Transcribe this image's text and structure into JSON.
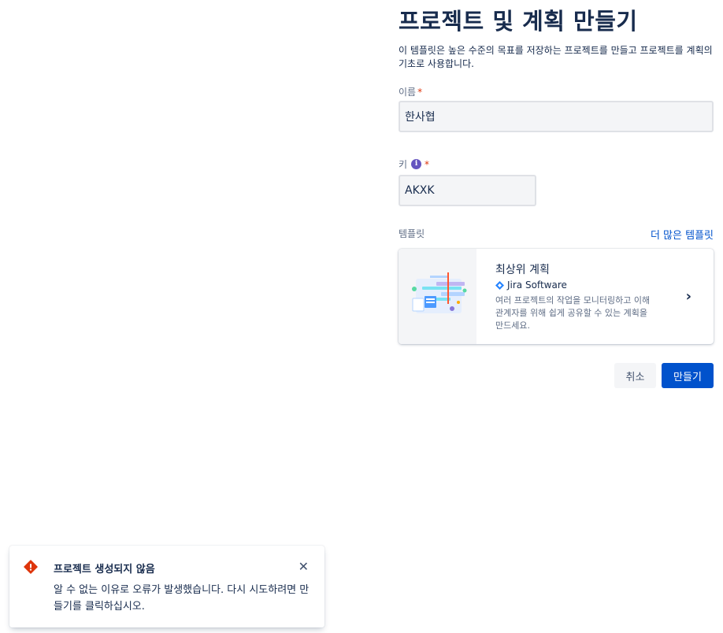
{
  "header": {
    "title": "프로젝트 및 계획 만들기",
    "description": "이 템플릿은 높은 수준의 목표를 저장하는 프로젝트를 만들고 프로젝트를 계획의 기초로 사용합니다."
  },
  "form": {
    "name_label": "이름",
    "name_value": "한사협",
    "key_label": "키",
    "key_value": "AKXK",
    "required_mark": "*",
    "info_glyph": "i",
    "template_label": "템플릿",
    "more_templates_link": "더 많은 템플릿"
  },
  "template_card": {
    "title": "최상위 계획",
    "product": "Jira Software",
    "description": "여러 프로젝트의 작업을 모니터링하고 이해 관계자를 위해 쉽게 공유할 수 있는 계획을 만드세요.",
    "chevron": "›"
  },
  "actions": {
    "cancel_label": "취소",
    "create_label": "만들기"
  },
  "toast": {
    "title": "프로젝트 생성되지 않음",
    "body": "알 수 없는 이유로 오류가 발생했습니다. 다시 시도하려면 만들기를 클릭하십시오.",
    "close_glyph": "✕"
  },
  "colors": {
    "primary": "#0052cc",
    "error": "#de350b",
    "info": "#6554c0"
  }
}
